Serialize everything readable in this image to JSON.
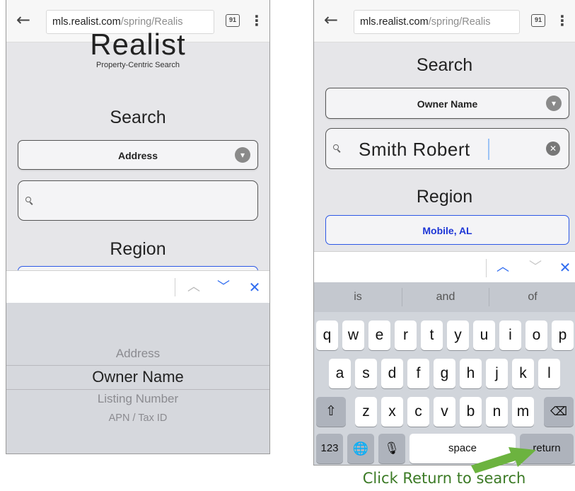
{
  "left_screen": {
    "browser": {
      "url_host": "mls.realist.com",
      "url_path": "/spring/Realis",
      "tab_count": "91"
    },
    "logo": "Realist",
    "tagline": "Property-Centric Search",
    "search_heading": "Search",
    "search_type": "Address",
    "search_value": "",
    "region_heading": "Region",
    "picker_options": [
      "Address",
      "Owner Name",
      "Listing Number",
      "APN / Tax ID"
    ],
    "picker_selected": "Owner Name"
  },
  "right_screen": {
    "browser": {
      "url_host": "mls.realist.com",
      "url_path": "/spring/Realis",
      "tab_count": "91"
    },
    "search_heading": "Search",
    "search_type": "Owner Name",
    "search_value": "Smith Robert",
    "region_heading": "Region",
    "region_value": "Mobile, AL",
    "keyboard": {
      "suggestions": [
        "is",
        "and",
        "of"
      ],
      "row1": [
        "q",
        "w",
        "e",
        "r",
        "t",
        "y",
        "u",
        "i",
        "o",
        "p"
      ],
      "row2": [
        "a",
        "s",
        "d",
        "f",
        "g",
        "h",
        "j",
        "k",
        "l"
      ],
      "row3": [
        "z",
        "x",
        "c",
        "v",
        "b",
        "n",
        "m"
      ],
      "numbers_label": "123",
      "space_label": "space",
      "return_label": "return"
    }
  },
  "annotation": {
    "caption": "Click Return to search",
    "arrow_color": "#6cb33f"
  }
}
